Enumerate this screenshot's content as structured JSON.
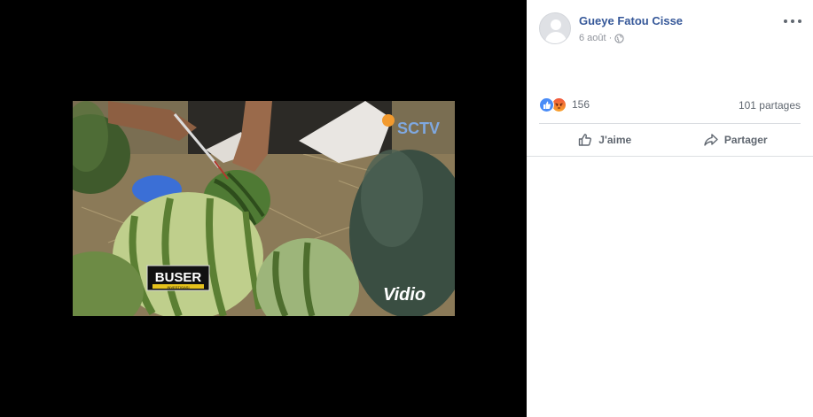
{
  "post": {
    "author": "Gueye Fatou Cisse",
    "date": "6 août",
    "separator": "·",
    "privacy_icon": "globe-icon"
  },
  "media": {
    "channel_logo": "SCTV",
    "show_title": "BUSER",
    "show_subtitle": "INVESTIGASI",
    "watermark": "Vidio"
  },
  "engagement": {
    "reaction_icons": [
      "like-icon",
      "angry-icon"
    ],
    "reaction_count": "156",
    "shares": "101 partages"
  },
  "actions": {
    "like_label": "J'aime",
    "share_label": "Partager"
  },
  "colors": {
    "author_link": "#365899",
    "secondary_text": "#606770",
    "like_blue": "#4a8cf7",
    "panel_border": "#dddfe2"
  }
}
